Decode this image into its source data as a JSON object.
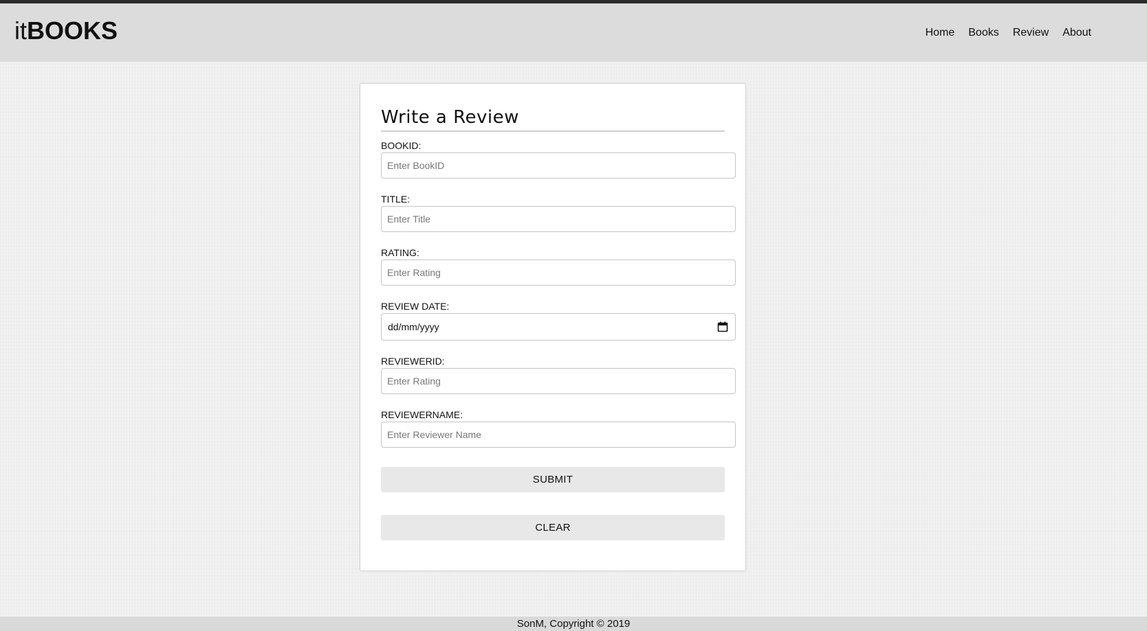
{
  "header": {
    "logo_prefix": "it",
    "logo_main": "BOOKS",
    "nav": [
      "Home",
      "Books",
      "Review",
      "About"
    ]
  },
  "form": {
    "title": "Write a Review",
    "fields": {
      "bookid": {
        "label": "BOOKID:",
        "placeholder": "Enter BookID"
      },
      "title": {
        "label": "TITLE:",
        "placeholder": "Enter Title"
      },
      "rating": {
        "label": "RATING:",
        "placeholder": "Enter Rating"
      },
      "review_date": {
        "label": "REVIEW DATE:",
        "value": "dd/mm/yyyy",
        "icon": "calendar-icon"
      },
      "reviewerid": {
        "label": "REVIEWERID:",
        "placeholder": "Enter Rating"
      },
      "reviewername": {
        "label": "REVIEWERNAME:",
        "placeholder": "Enter Reviewer Name"
      }
    },
    "submit_label": "SUBMIT",
    "clear_label": "CLEAR"
  },
  "footer": {
    "text": "SonM, Copyright © 2019"
  }
}
